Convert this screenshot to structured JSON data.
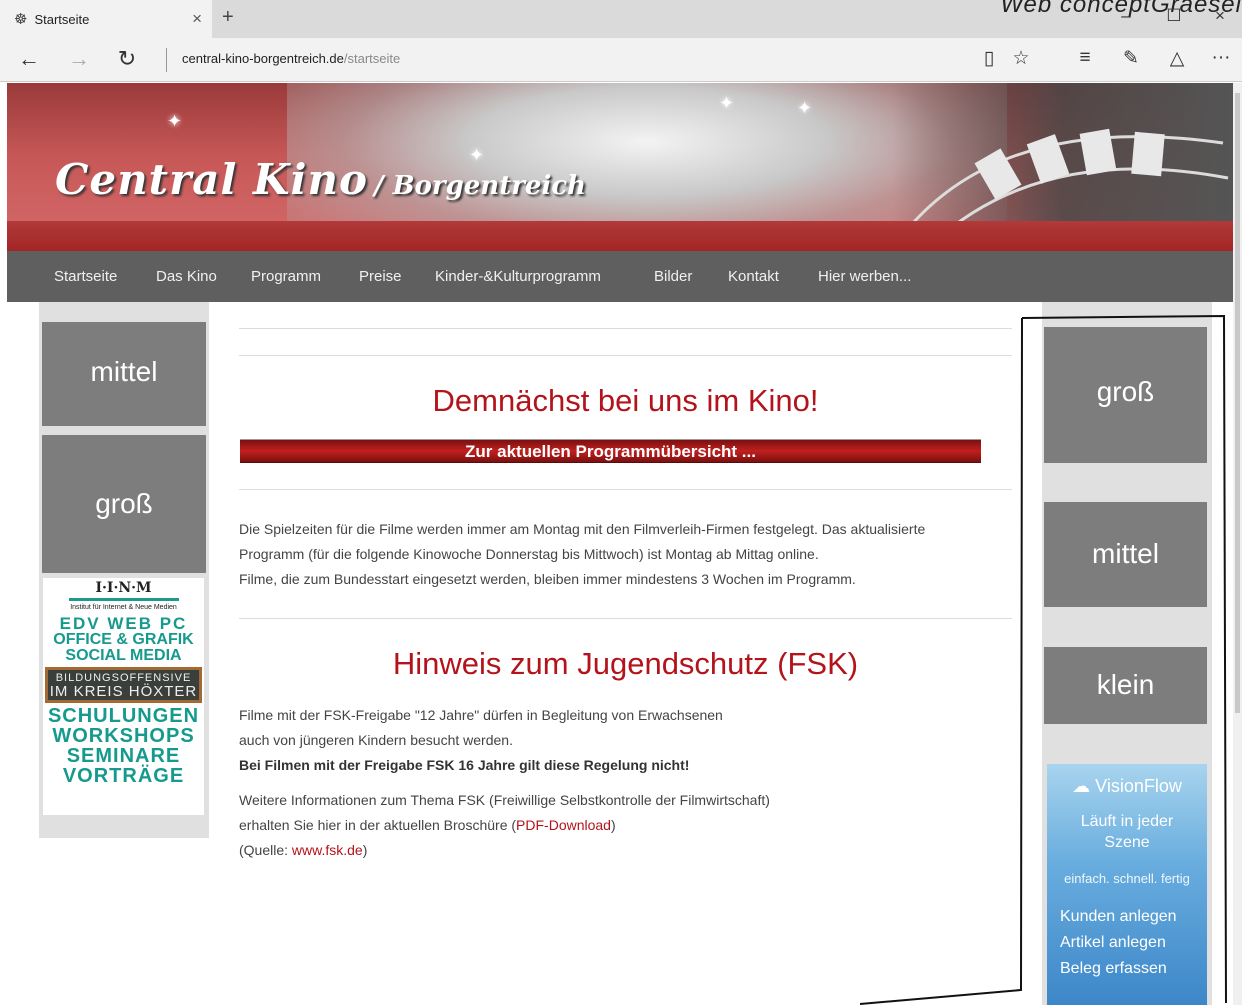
{
  "browser": {
    "tab_title": "Startseite",
    "tab_favicon": "☸",
    "tab_close": "×",
    "new_tab": "+",
    "window_controls": [
      "–",
      "☐",
      "×"
    ],
    "watermark": "Web conceptGraesel",
    "back": "←",
    "forward": "→",
    "refresh": "↻",
    "address_domain": "central-kino-borgentreich.de",
    "address_path": "/startseite",
    "toolbar_icons": {
      "reading": "▯",
      "favorite": "☆",
      "hub": "≡",
      "notes": "✎",
      "share": "△",
      "more": "···"
    }
  },
  "site": {
    "logo_main": "Central Kino",
    "logo_sub": "/ Borgentreich",
    "menu": [
      "Startseite",
      "Das Kino",
      "Programm",
      "Preise",
      "Kinder-&Kulturprogramm",
      "Bilder",
      "Kontakt",
      "Hier werben..."
    ]
  },
  "left_sidebar": {
    "ads": [
      "mittel",
      "groß"
    ],
    "inm": {
      "title": "I·I·N·M",
      "subtitle": "Institut für Internet & Neue Medien",
      "line1": "EDV WEB PC",
      "line2": "OFFICE & GRAFIK",
      "line3": "SOCIAL MEDIA",
      "board1": "BILDUNGSOFFENSIVE",
      "board2": "IM KREIS HÖXTER",
      "line4": "SCHULUNGEN",
      "line5": "WORKSHOPS",
      "line6": "SEMINARE",
      "line7": "VORTRÄGE"
    }
  },
  "main": {
    "heading1": "Demnächst bei uns im Kino!",
    "program_link": "Zur aktuellen Programmübersicht ...",
    "para1_line1": "Die Spielzeiten für die Filme werden immer am Montag mit den Filmverleih-Firmen festgelegt. Das aktualisierte",
    "para1_line2": "Programm (für die folgende Kinowoche Donnerstag bis Mittwoch) ist Montag ab Mittag online.",
    "para1_line3": "Filme, die zum Bundesstart eingesetzt werden, bleiben immer mindestens 3 Wochen im Programm.",
    "heading2": "Hinweis zum Jugendschutz (FSK)",
    "fsk_line1": "Filme mit der FSK-Freigabe \"12 Jahre\" dürfen in Begleitung von Erwachsenen",
    "fsk_line2": "auch von jüngeren Kindern besucht werden.",
    "fsk_bold": "Bei Filmen mit der Freigabe FSK 16 Jahre gilt diese Regelung nicht!",
    "info_line1": "Weitere Informationen zum Thema FSK (Freiwillige Selbstkontrolle der Filmwirtschaft)",
    "info_line2_pre": "erhalten Sie hier in der aktuellen Broschüre (",
    "pdf_link": "PDF-Download",
    "info_line2_post": ")",
    "source_pre": "(Quelle: ",
    "source_link": "www.fsk.de",
    "source_post": ")"
  },
  "right_sidebar": {
    "ads": [
      "groß",
      "mittel",
      "klein"
    ],
    "visionflow": {
      "brand": "VisionFlow",
      "claim_line1": "Läuft in jeder",
      "claim_line2": "Szene",
      "tagline": "einfach. schnell. fertig",
      "items": [
        "Kunden anlegen",
        "Artikel anlegen",
        "Beleg erfassen"
      ]
    }
  },
  "colors": {
    "accent_red": "#b3141b",
    "menu_bg": "#5f5f5f",
    "ad_gray": "#7d7d7d",
    "sidebar_bg": "#e0e0e0"
  }
}
